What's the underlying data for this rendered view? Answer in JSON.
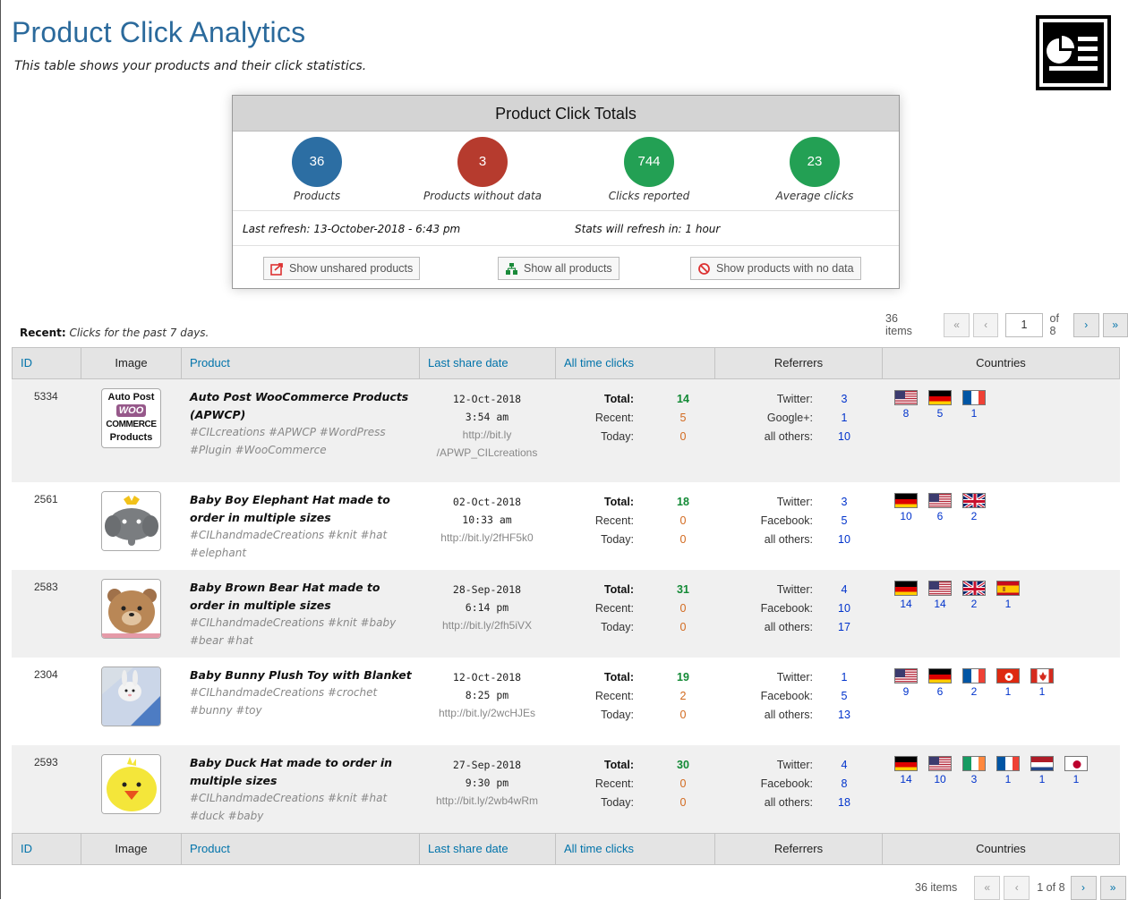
{
  "header": {
    "title": "Product Click Analytics",
    "subtitle": "This table shows your products and their click statistics."
  },
  "totals": {
    "heading": "Product Click Totals",
    "stats": [
      {
        "value": "36",
        "label": "Products",
        "color": "#2c6ea3"
      },
      {
        "value": "3",
        "label": "Products without data",
        "color": "#b63b2e"
      },
      {
        "value": "744",
        "label": "Clicks reported",
        "color": "#23a054"
      },
      {
        "value": "23",
        "label": "Average clicks",
        "color": "#23a054"
      }
    ],
    "last_refresh": "Last refresh: 13-October-2018 - 6:43 pm",
    "next_refresh": "Stats will refresh in: 1 hour",
    "buttons": {
      "unshared": "Show unshared products",
      "all": "Show all products",
      "nodata": "Show products with no data"
    }
  },
  "recent": {
    "label": "Recent:",
    "text": "Clicks for the past 7 days."
  },
  "pager": {
    "items": "36 items",
    "first": "«",
    "prev": "‹",
    "current": "1",
    "of": "of 8",
    "next": "›",
    "last": "»",
    "bottom_text": "1 of 8"
  },
  "table": {
    "columns": [
      "ID",
      "Image",
      "Product",
      "Last share date",
      "All time clicks",
      "Referrers",
      "Countries"
    ],
    "click_labels": {
      "total": "Total:",
      "recent": "Recent:",
      "today": "Today:"
    },
    "rows": [
      {
        "id": "5334",
        "image": "Auto Post WooCommerce Products",
        "image_lines": [
          "Auto Post",
          "WOO",
          "COMMERCE",
          "Products"
        ],
        "name": "Auto Post WooCommerce Products (APWCP)",
        "tags": "#CILcreations #APWCP #WordPress #Plugin #WooCommerce",
        "date": "12-Oct-2018",
        "time": "3:54 am",
        "url": "http://bit.ly /APWP_CILcreations",
        "total": "14",
        "recent": "5",
        "today": "0",
        "refs": [
          {
            "name": "Twitter:",
            "v": "3"
          },
          {
            "name": "Google+:",
            "v": "1"
          },
          {
            "name": "all others:",
            "v": "10"
          }
        ],
        "countries": [
          {
            "flag": "us",
            "v": "8"
          },
          {
            "flag": "de",
            "v": "5"
          },
          {
            "flag": "fr",
            "v": "1"
          }
        ]
      },
      {
        "id": "2561",
        "image": "Baby Boy Elephant Hat",
        "name": "Baby Boy Elephant Hat made to order in multiple sizes",
        "tags": "#CILhandmadeCreations #knit #hat #elephant",
        "date": "02-Oct-2018",
        "time": "10:33 am",
        "url": "http://bit.ly/2fHF5k0",
        "total": "18",
        "recent": "0",
        "today": "0",
        "refs": [
          {
            "name": "Twitter:",
            "v": "3"
          },
          {
            "name": "Facebook:",
            "v": "5"
          },
          {
            "name": "all others:",
            "v": "10"
          }
        ],
        "countries": [
          {
            "flag": "de",
            "v": "10"
          },
          {
            "flag": "us",
            "v": "6"
          },
          {
            "flag": "gb",
            "v": "2"
          }
        ]
      },
      {
        "id": "2583",
        "image": "Baby Brown Bear Hat",
        "name": "Baby Brown Bear Hat made to order in multiple sizes",
        "tags": "#CILhandmadeCreations #knit #baby #bear #hat",
        "date": "28-Sep-2018",
        "time": "6:14 pm",
        "url": "http://bit.ly/2fh5iVX",
        "total": "31",
        "recent": "0",
        "today": "0",
        "refs": [
          {
            "name": "Twitter:",
            "v": "4"
          },
          {
            "name": "Facebook:",
            "v": "10"
          },
          {
            "name": "all others:",
            "v": "17"
          }
        ],
        "countries": [
          {
            "flag": "de",
            "v": "14"
          },
          {
            "flag": "us",
            "v": "14"
          },
          {
            "flag": "gb",
            "v": "2"
          },
          {
            "flag": "es",
            "v": "1"
          }
        ]
      },
      {
        "id": "2304",
        "image": "Baby Bunny Plush Toy",
        "name": "Baby Bunny Plush Toy with Blanket",
        "tags": "#CILhandmadeCreations #crochet #bunny #toy",
        "date": "12-Oct-2018",
        "time": "8:25 pm",
        "url": "http://bit.ly/2wcHJEs",
        "total": "19",
        "recent": "2",
        "today": "0",
        "refs": [
          {
            "name": "Twitter:",
            "v": "1"
          },
          {
            "name": "Facebook:",
            "v": "5"
          },
          {
            "name": "all others:",
            "v": "13"
          }
        ],
        "countries": [
          {
            "flag": "us",
            "v": "9"
          },
          {
            "flag": "de",
            "v": "6"
          },
          {
            "flag": "fr",
            "v": "2"
          },
          {
            "flag": "hk",
            "v": "1"
          },
          {
            "flag": "ca",
            "v": "1"
          }
        ]
      },
      {
        "id": "2593",
        "image": "Baby Duck Hat",
        "name": "Baby Duck Hat made to order in multiple sizes",
        "tags": "#CILhandmadeCreations #knit #hat #duck #baby",
        "date": "27-Sep-2018",
        "time": "9:30 pm",
        "url": "http://bit.ly/2wb4wRm",
        "total": "30",
        "recent": "0",
        "today": "0",
        "refs": [
          {
            "name": "Twitter:",
            "v": "4"
          },
          {
            "name": "Facebook:",
            "v": "8"
          },
          {
            "name": "all others:",
            "v": "18"
          }
        ],
        "countries": [
          {
            "flag": "de",
            "v": "14"
          },
          {
            "flag": "us",
            "v": "10"
          },
          {
            "flag": "ie",
            "v": "3"
          },
          {
            "flag": "fr",
            "v": "1"
          },
          {
            "flag": "nl",
            "v": "1"
          },
          {
            "flag": "jp",
            "v": "1"
          }
        ]
      }
    ]
  }
}
